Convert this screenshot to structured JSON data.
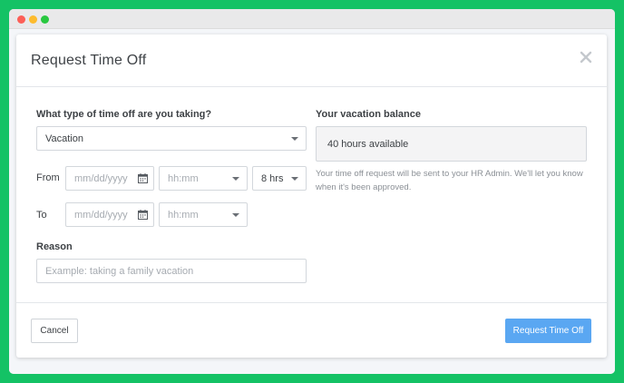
{
  "modal": {
    "title": "Request Time Off"
  },
  "form": {
    "type_question": "What type of time off are you taking?",
    "type_value": "Vacation",
    "from_label": "From",
    "to_label": "To",
    "from_date_placeholder": "mm/dd/yyyy",
    "from_time_placeholder": "hh:mm",
    "from_hours_value": "8 hrs",
    "to_date_placeholder": "mm/dd/yyyy",
    "to_time_placeholder": "hh:mm",
    "reason_label": "Reason",
    "reason_placeholder": "Example: taking a family vacation"
  },
  "balance": {
    "heading": "Your vacation balance",
    "value": "40 hours available",
    "helper": "Your time off request will be sent to your HR Admin. We'll let you know when it's been approved."
  },
  "footer": {
    "cancel_label": "Cancel",
    "submit_label": "Request Time Off"
  },
  "colors": {
    "frame_bg": "#14c265",
    "primary": "#5aa7f2",
    "close_icon": "#c4c8cd"
  },
  "icons": {
    "close": "close-icon",
    "calendar": "calendar-icon",
    "dropdown": "chevron-down-icon"
  }
}
